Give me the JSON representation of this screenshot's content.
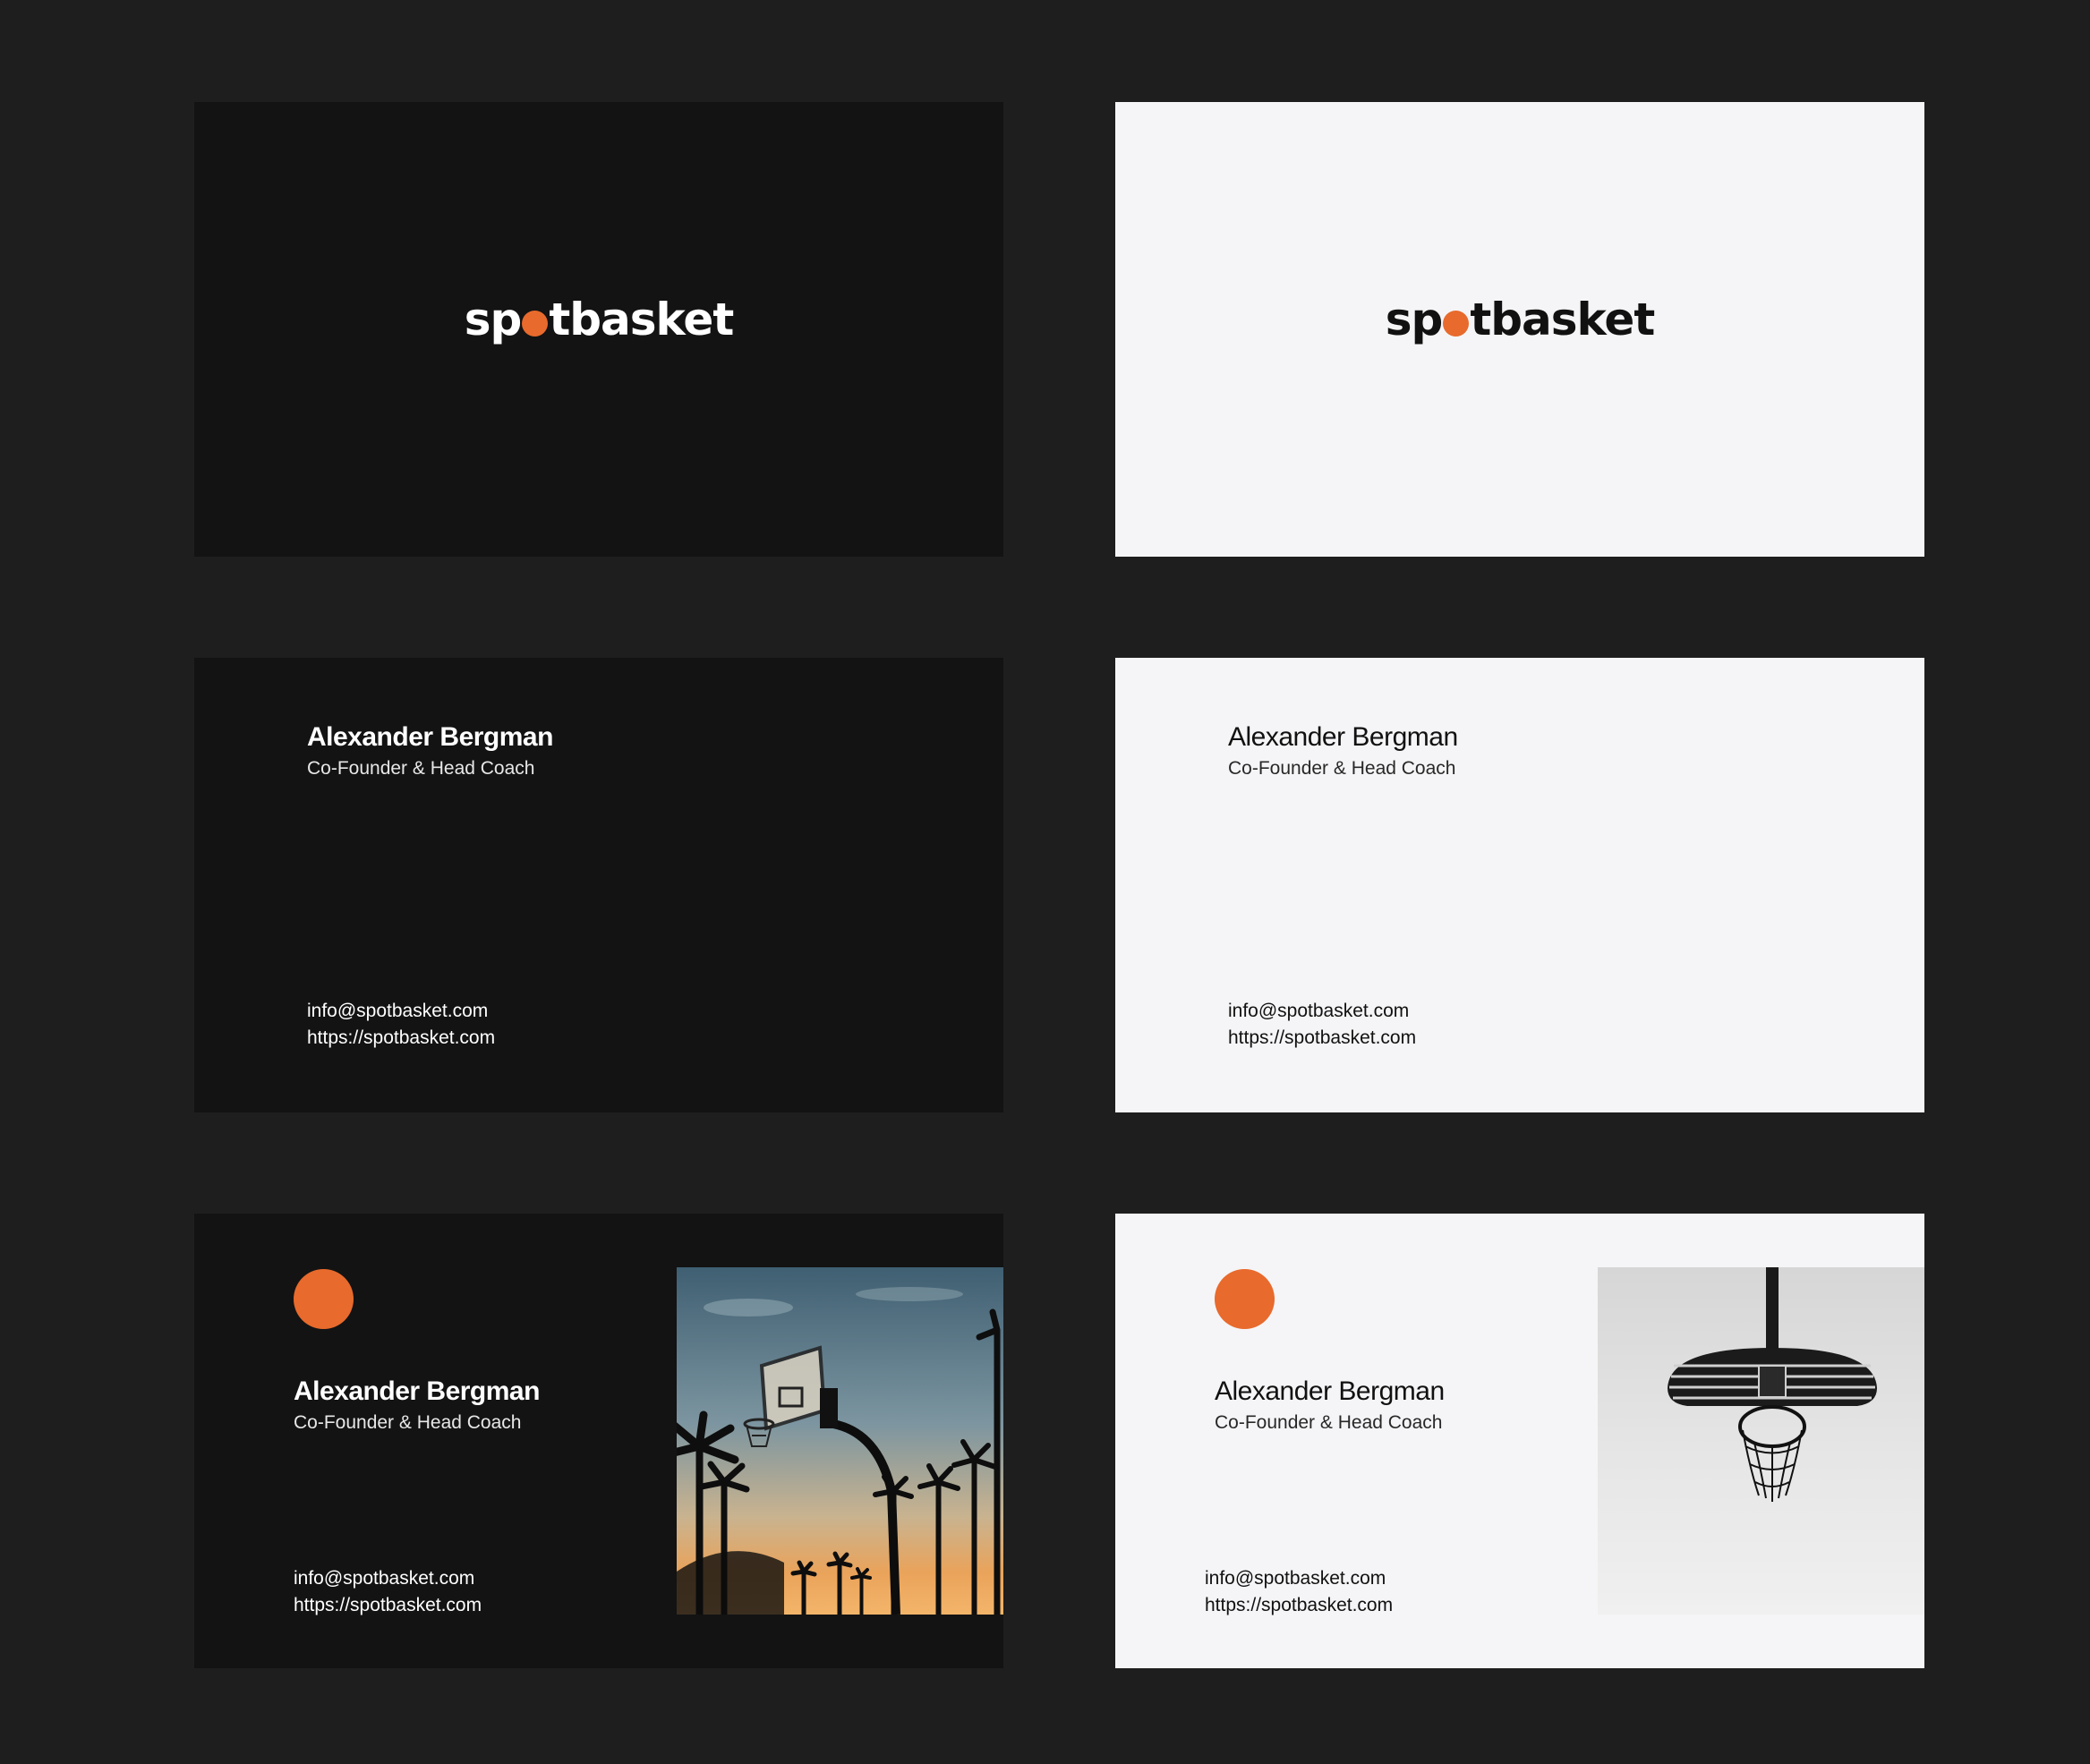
{
  "brand": {
    "name_left": "sp",
    "name_right": "tbasket",
    "accent_color": "#e86a2c"
  },
  "person": {
    "name": "Alexander Bergman",
    "role": "Co-Founder & Head Coach"
  },
  "contact": {
    "email": "info@spotbasket.com",
    "website": "https://spotbasket.com"
  },
  "colors": {
    "page_background": "#1e1e1e",
    "card_dark": "#131313",
    "card_light": "#f5f5f7"
  },
  "images": {
    "dark_photo": "sunset-basketball-hoop-palm-trees",
    "light_photo": "basketball-hoop-backboard-from-below"
  }
}
